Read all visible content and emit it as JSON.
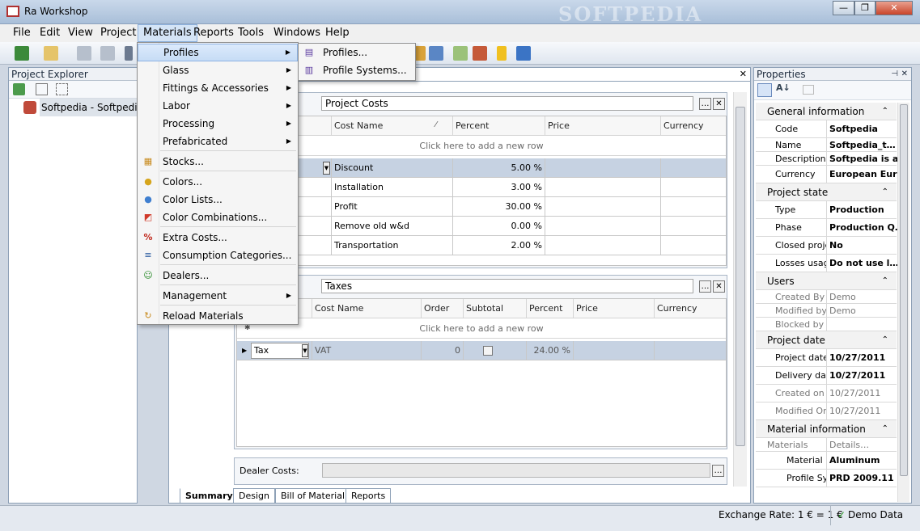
{
  "window": {
    "title": "Ra Workshop",
    "watermark": "SOFTPEDIA",
    "min": "—",
    "max": "❐",
    "close": "✕"
  },
  "menubar": [
    "File",
    "Edit",
    "View",
    "Project",
    "Materials",
    "Reports",
    "Tools",
    "Windows",
    "Help"
  ],
  "project_explorer": {
    "title": "Project Explorer",
    "tree_item": "Softpedia - Softpedia_tes"
  },
  "center": {
    "close": "✕",
    "project_costs": {
      "title": "Project Costs",
      "columns": [
        "Cost Name",
        "Percent",
        "Price",
        "Currency"
      ],
      "add_row": "Click here to add a new row",
      "rows": [
        {
          "name": "Discount",
          "percent": "5.00 %"
        },
        {
          "name": "Installation",
          "percent": "3.00 %"
        },
        {
          "name": "Profit",
          "percent": "30.00 %"
        },
        {
          "name": "Remove old w&d",
          "percent": "0.00 %"
        },
        {
          "name": "Transportation",
          "percent": "2.00 %"
        }
      ]
    },
    "taxes": {
      "title": "Taxes",
      "columns": [
        "Cost Name",
        "Order",
        "Subtotal",
        "Percent",
        "Price",
        "Currency"
      ],
      "add_row": "Click here to add a new row",
      "row": {
        "type": "Tax",
        "name": "VAT",
        "order": "0",
        "percent": "24.00 %"
      }
    },
    "dealer_costs_label": "Dealer Costs:",
    "tabs": [
      "Summary",
      "Design",
      "Bill of Material",
      "Reports"
    ]
  },
  "properties": {
    "title": "Properties",
    "categories": [
      {
        "name": "General information",
        "rows": [
          [
            "Code",
            "Softpedia"
          ],
          [
            "Name",
            "Softpedia_t…"
          ],
          [
            "Description",
            "Softpedia is a l"
          ],
          [
            "Currency",
            "European Euro"
          ]
        ]
      },
      {
        "name": "Project state",
        "rows": [
          [
            "Type",
            "Production"
          ],
          [
            "Phase",
            "Production Q…"
          ],
          [
            "Closed proje",
            "No"
          ],
          [
            "Losses usag",
            "Do not use l…"
          ]
        ]
      },
      {
        "name": "Users",
        "rows": [
          [
            "Created By",
            "Demo"
          ],
          [
            "Modified by",
            "Demo"
          ],
          [
            "Blocked by",
            ""
          ]
        ]
      },
      {
        "name": "Project date",
        "rows": [
          [
            "Project date",
            "10/27/2011"
          ],
          [
            "Delivery dat",
            "10/27/2011"
          ],
          [
            "Created on",
            "10/27/2011"
          ],
          [
            "Modified On",
            "10/27/2011"
          ]
        ]
      },
      {
        "name": "Material information",
        "rows": [
          [
            "Materials",
            "Details…"
          ],
          [
            "Material",
            "Aluminum"
          ],
          [
            "Profile Sy:",
            "PRD 2009.11"
          ]
        ]
      }
    ]
  },
  "materials_menu": {
    "items": [
      {
        "label": "Profiles",
        "sub": true,
        "icon": ""
      },
      {
        "label": "Glass",
        "sub": true,
        "icon": ""
      },
      {
        "label": "Fittings & Accessories",
        "sub": true,
        "icon": ""
      },
      {
        "label": "Labor",
        "sub": true,
        "icon": ""
      },
      {
        "label": "Processing",
        "sub": true,
        "icon": ""
      },
      {
        "label": "Prefabricated",
        "sub": true,
        "icon": ""
      },
      {
        "label": "Stocks...",
        "sub": false,
        "icon": "▦"
      },
      {
        "label": "Colors...",
        "sub": false,
        "icon": "●"
      },
      {
        "label": "Color Lists...",
        "sub": false,
        "icon": "●"
      },
      {
        "label": "Color Combinations...",
        "sub": false,
        "icon": "◩"
      },
      {
        "label": "Extra Costs...",
        "sub": false,
        "icon": "%"
      },
      {
        "label": "Consumption Categories...",
        "sub": false,
        "icon": "≡"
      },
      {
        "label": "Dealers...",
        "sub": false,
        "icon": "☺"
      },
      {
        "label": "Management",
        "sub": true,
        "icon": ""
      },
      {
        "label": "Reload Materials",
        "sub": false,
        "icon": "↻"
      }
    ]
  },
  "profiles_submenu": [
    "Profiles...",
    "Profile Systems..."
  ],
  "status": {
    "exchange_rate": "Exchange Rate: 1 € = 1 €",
    "demo": "Demo Data",
    "check": "✓"
  },
  "colors": {
    "accent": "#c6dcf5",
    "selection": "#c6d2e2",
    "frame": "#8ea1b7"
  }
}
